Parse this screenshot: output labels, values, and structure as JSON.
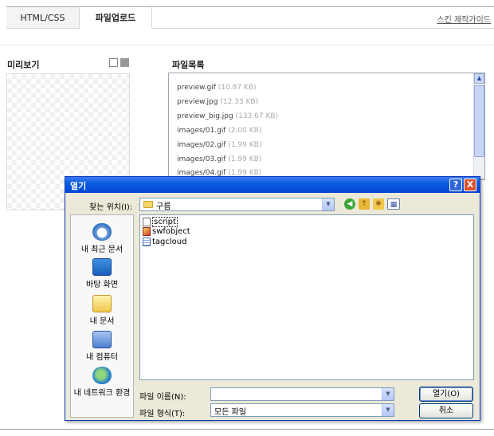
{
  "editor": {
    "tabs": [
      {
        "label": "HTML/CSS"
      },
      {
        "label": "파일업로드"
      }
    ],
    "guide_link": "스킨 제작가이드",
    "preview_title": "미리보기",
    "file_list_title": "파일목록",
    "files": [
      {
        "name": "preview.gif",
        "size": "(10.87 KB)"
      },
      {
        "name": "preview.jpg",
        "size": "(12.33 KB)"
      },
      {
        "name": "preview_big.jpg",
        "size": "(133.67 KB)"
      },
      {
        "name": "images/01.gif",
        "size": "(2.00 KB)"
      },
      {
        "name": "images/02.gif",
        "size": "(1.99 KB)"
      },
      {
        "name": "images/03.gif",
        "size": "(1.99 KB)"
      },
      {
        "name": "images/04.gif",
        "size": "(1.99 KB)"
      }
    ]
  },
  "dialog": {
    "title": "열기",
    "help_label": "?",
    "close_label": "X",
    "look_in_label": "찾는 위치(I):",
    "look_in_value": "구름",
    "places": [
      {
        "label": "내 최근 문서",
        "icon": "recent-documents-icon"
      },
      {
        "label": "바탕 화면",
        "icon": "desktop-icon"
      },
      {
        "label": "내 문서",
        "icon": "my-documents-icon"
      },
      {
        "label": "내 컴퓨터",
        "icon": "my-computer-icon"
      },
      {
        "label": "내 네트워크 환경",
        "icon": "network-icon"
      }
    ],
    "files": [
      {
        "name": "script",
        "icon": "text-file-icon"
      },
      {
        "name": "swfobject",
        "icon": "script-file-icon"
      },
      {
        "name": "tagcloud",
        "icon": "html-file-icon"
      }
    ],
    "file_name_label": "파일 이름(N):",
    "file_name_value": "",
    "file_type_label": "파일 형식(T):",
    "file_type_value": "모든 파일",
    "open_button": "열기(O)",
    "cancel_button": "취소"
  }
}
